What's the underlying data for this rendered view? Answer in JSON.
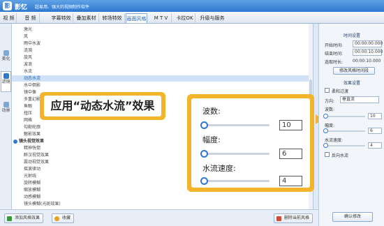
{
  "app": {
    "logo": "影",
    "name": "影忆",
    "slogan": "超易用、强大的视频制作软件"
  },
  "menu": {
    "tabs": [
      {
        "label": "视 频"
      },
      {
        "label": "音 频"
      },
      {
        "label": "字幕特效"
      },
      {
        "label": "叠加素材"
      },
      {
        "label": "转场特效"
      },
      {
        "label": "画面风格"
      },
      {
        "label": "M T V"
      },
      {
        "label": "卡拉OK"
      },
      {
        "label": "升级与服务"
      }
    ],
    "active_tab": "画面风格"
  },
  "side_tabs": [
    {
      "label": "滤镜",
      "icon": "filter-icon"
    },
    {
      "label": "美化",
      "icon": "beautify-icon"
    },
    {
      "label": "动景",
      "icon": "motion-icon"
    }
  ],
  "effects_list": {
    "items": [
      "激光",
      "风",
      "雨中水波",
      "涟漪",
      "旋风",
      "波浪",
      "水流",
      "动态水流",
      "水中倒影",
      "镜中像",
      "多重幻影",
      "鱼眼",
      "扭压",
      "网格",
      "勾勒轮廓",
      "魅影效果"
    ],
    "selected": "动态水流",
    "group": "镜头视觉效果",
    "group_items": [
      "精神恍惚",
      "醉汉视觉效果",
      "震动视觉效果",
      "摇滚律动",
      "光射线",
      "旋转模糊",
      "缩放模糊",
      "动感模糊",
      "镜头模糊(光斑效果)"
    ]
  },
  "callout": {
    "text": "应用“动态水流”效果"
  },
  "zoom": {
    "params": [
      {
        "label": "波数:",
        "value": "10"
      },
      {
        "label": "幅度:",
        "value": "6"
      },
      {
        "label": "水流速度:",
        "value": "4"
      }
    ]
  },
  "right_panel": {
    "time_title": "时间设置",
    "start_label": "开始时间:",
    "start_value": "00:00:00.000",
    "end_label": "结束时间:",
    "end_value": "00:00:10.000",
    "duration_label": "选取时长:",
    "duration_value": "00:00:10.000",
    "modify_time_button": "修改风格时间段",
    "effect_title": "效果设置",
    "soft_transition": "柔和过渡",
    "direction_label": "方向:",
    "direction_value": "垂直流",
    "waves_label": "波数:",
    "waves_value": "10",
    "amplitude_label": "幅度:",
    "amplitude_value": "6",
    "speed_label": "水流速度:",
    "speed_value": "4",
    "reverse_flow": "反向水流"
  },
  "bottom": {
    "add_button": "添加风格效果",
    "collect_button": "收藏",
    "delete_button": "删除当前风格",
    "confirm_button": "确认修改"
  }
}
